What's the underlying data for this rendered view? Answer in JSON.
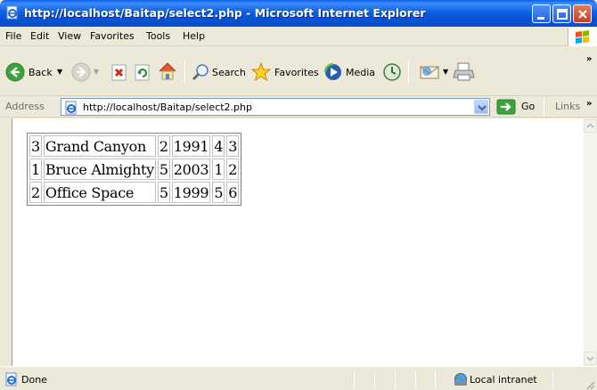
{
  "window": {
    "title": "http://localhost/Baitap/select2.php - Microsoft Internet Explorer"
  },
  "menu": [
    "File",
    "Edit",
    "View",
    "Favorites",
    "Tools",
    "Help"
  ],
  "toolbar": {
    "back_label": "Back",
    "search_label": "Search",
    "favorites_label": "Favorites",
    "media_label": "Media"
  },
  "address": {
    "label": "Address",
    "url": "http://localhost/Baitap/select2.php",
    "go_label": "Go",
    "links_label": "Links"
  },
  "table": {
    "rows": [
      [
        "3",
        "Grand Canyon",
        "2",
        "1991",
        "4",
        "3"
      ],
      [
        "1",
        "Bruce Almighty",
        "5",
        "2003",
        "1",
        "2"
      ],
      [
        "2",
        "Office Space",
        "5",
        "1999",
        "5",
        "6"
      ]
    ]
  },
  "status": {
    "text": "Done",
    "zone": "Local intranet"
  }
}
